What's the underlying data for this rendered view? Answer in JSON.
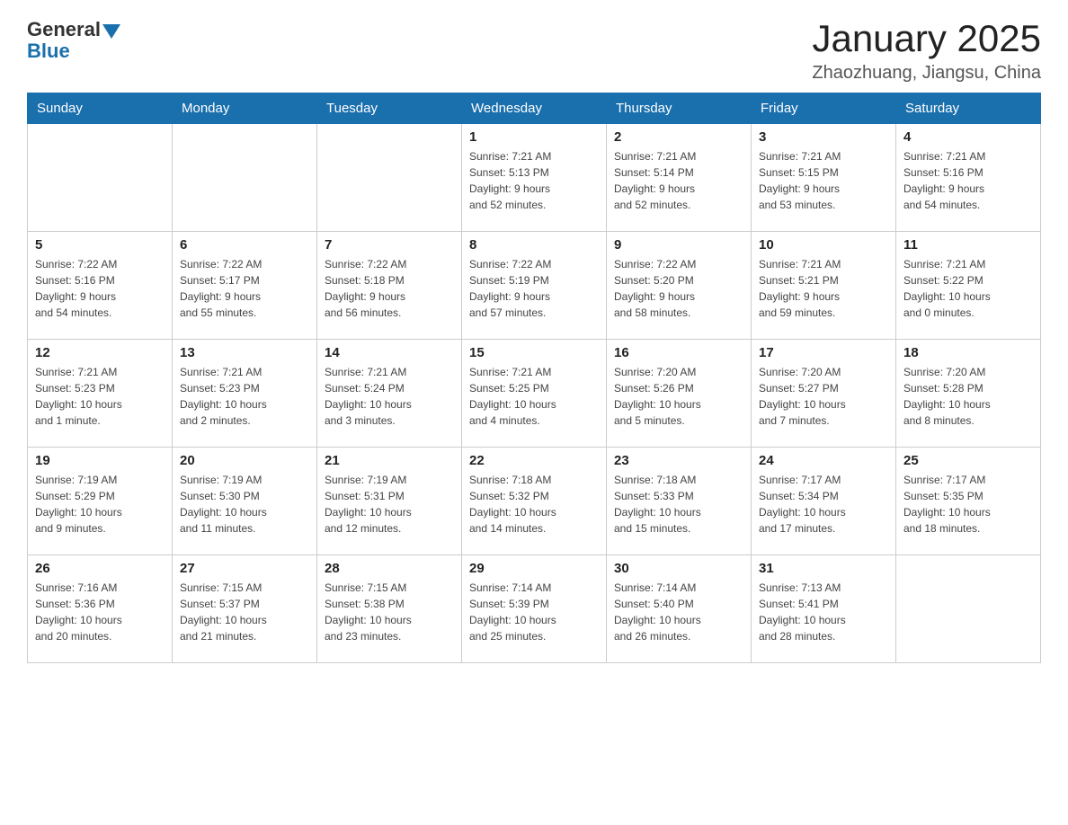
{
  "header": {
    "logo": {
      "general": "General",
      "blue": "Blue"
    },
    "title": "January 2025",
    "subtitle": "Zhaozhuang, Jiangsu, China"
  },
  "days_of_week": [
    "Sunday",
    "Monday",
    "Tuesday",
    "Wednesday",
    "Thursday",
    "Friday",
    "Saturday"
  ],
  "weeks": [
    [
      {
        "day": "",
        "info": ""
      },
      {
        "day": "",
        "info": ""
      },
      {
        "day": "",
        "info": ""
      },
      {
        "day": "1",
        "info": "Sunrise: 7:21 AM\nSunset: 5:13 PM\nDaylight: 9 hours\nand 52 minutes."
      },
      {
        "day": "2",
        "info": "Sunrise: 7:21 AM\nSunset: 5:14 PM\nDaylight: 9 hours\nand 52 minutes."
      },
      {
        "day": "3",
        "info": "Sunrise: 7:21 AM\nSunset: 5:15 PM\nDaylight: 9 hours\nand 53 minutes."
      },
      {
        "day": "4",
        "info": "Sunrise: 7:21 AM\nSunset: 5:16 PM\nDaylight: 9 hours\nand 54 minutes."
      }
    ],
    [
      {
        "day": "5",
        "info": "Sunrise: 7:22 AM\nSunset: 5:16 PM\nDaylight: 9 hours\nand 54 minutes."
      },
      {
        "day": "6",
        "info": "Sunrise: 7:22 AM\nSunset: 5:17 PM\nDaylight: 9 hours\nand 55 minutes."
      },
      {
        "day": "7",
        "info": "Sunrise: 7:22 AM\nSunset: 5:18 PM\nDaylight: 9 hours\nand 56 minutes."
      },
      {
        "day": "8",
        "info": "Sunrise: 7:22 AM\nSunset: 5:19 PM\nDaylight: 9 hours\nand 57 minutes."
      },
      {
        "day": "9",
        "info": "Sunrise: 7:22 AM\nSunset: 5:20 PM\nDaylight: 9 hours\nand 58 minutes."
      },
      {
        "day": "10",
        "info": "Sunrise: 7:21 AM\nSunset: 5:21 PM\nDaylight: 9 hours\nand 59 minutes."
      },
      {
        "day": "11",
        "info": "Sunrise: 7:21 AM\nSunset: 5:22 PM\nDaylight: 10 hours\nand 0 minutes."
      }
    ],
    [
      {
        "day": "12",
        "info": "Sunrise: 7:21 AM\nSunset: 5:23 PM\nDaylight: 10 hours\nand 1 minute."
      },
      {
        "day": "13",
        "info": "Sunrise: 7:21 AM\nSunset: 5:23 PM\nDaylight: 10 hours\nand 2 minutes."
      },
      {
        "day": "14",
        "info": "Sunrise: 7:21 AM\nSunset: 5:24 PM\nDaylight: 10 hours\nand 3 minutes."
      },
      {
        "day": "15",
        "info": "Sunrise: 7:21 AM\nSunset: 5:25 PM\nDaylight: 10 hours\nand 4 minutes."
      },
      {
        "day": "16",
        "info": "Sunrise: 7:20 AM\nSunset: 5:26 PM\nDaylight: 10 hours\nand 5 minutes."
      },
      {
        "day": "17",
        "info": "Sunrise: 7:20 AM\nSunset: 5:27 PM\nDaylight: 10 hours\nand 7 minutes."
      },
      {
        "day": "18",
        "info": "Sunrise: 7:20 AM\nSunset: 5:28 PM\nDaylight: 10 hours\nand 8 minutes."
      }
    ],
    [
      {
        "day": "19",
        "info": "Sunrise: 7:19 AM\nSunset: 5:29 PM\nDaylight: 10 hours\nand 9 minutes."
      },
      {
        "day": "20",
        "info": "Sunrise: 7:19 AM\nSunset: 5:30 PM\nDaylight: 10 hours\nand 11 minutes."
      },
      {
        "day": "21",
        "info": "Sunrise: 7:19 AM\nSunset: 5:31 PM\nDaylight: 10 hours\nand 12 minutes."
      },
      {
        "day": "22",
        "info": "Sunrise: 7:18 AM\nSunset: 5:32 PM\nDaylight: 10 hours\nand 14 minutes."
      },
      {
        "day": "23",
        "info": "Sunrise: 7:18 AM\nSunset: 5:33 PM\nDaylight: 10 hours\nand 15 minutes."
      },
      {
        "day": "24",
        "info": "Sunrise: 7:17 AM\nSunset: 5:34 PM\nDaylight: 10 hours\nand 17 minutes."
      },
      {
        "day": "25",
        "info": "Sunrise: 7:17 AM\nSunset: 5:35 PM\nDaylight: 10 hours\nand 18 minutes."
      }
    ],
    [
      {
        "day": "26",
        "info": "Sunrise: 7:16 AM\nSunset: 5:36 PM\nDaylight: 10 hours\nand 20 minutes."
      },
      {
        "day": "27",
        "info": "Sunrise: 7:15 AM\nSunset: 5:37 PM\nDaylight: 10 hours\nand 21 minutes."
      },
      {
        "day": "28",
        "info": "Sunrise: 7:15 AM\nSunset: 5:38 PM\nDaylight: 10 hours\nand 23 minutes."
      },
      {
        "day": "29",
        "info": "Sunrise: 7:14 AM\nSunset: 5:39 PM\nDaylight: 10 hours\nand 25 minutes."
      },
      {
        "day": "30",
        "info": "Sunrise: 7:14 AM\nSunset: 5:40 PM\nDaylight: 10 hours\nand 26 minutes."
      },
      {
        "day": "31",
        "info": "Sunrise: 7:13 AM\nSunset: 5:41 PM\nDaylight: 10 hours\nand 28 minutes."
      },
      {
        "day": "",
        "info": ""
      }
    ]
  ]
}
